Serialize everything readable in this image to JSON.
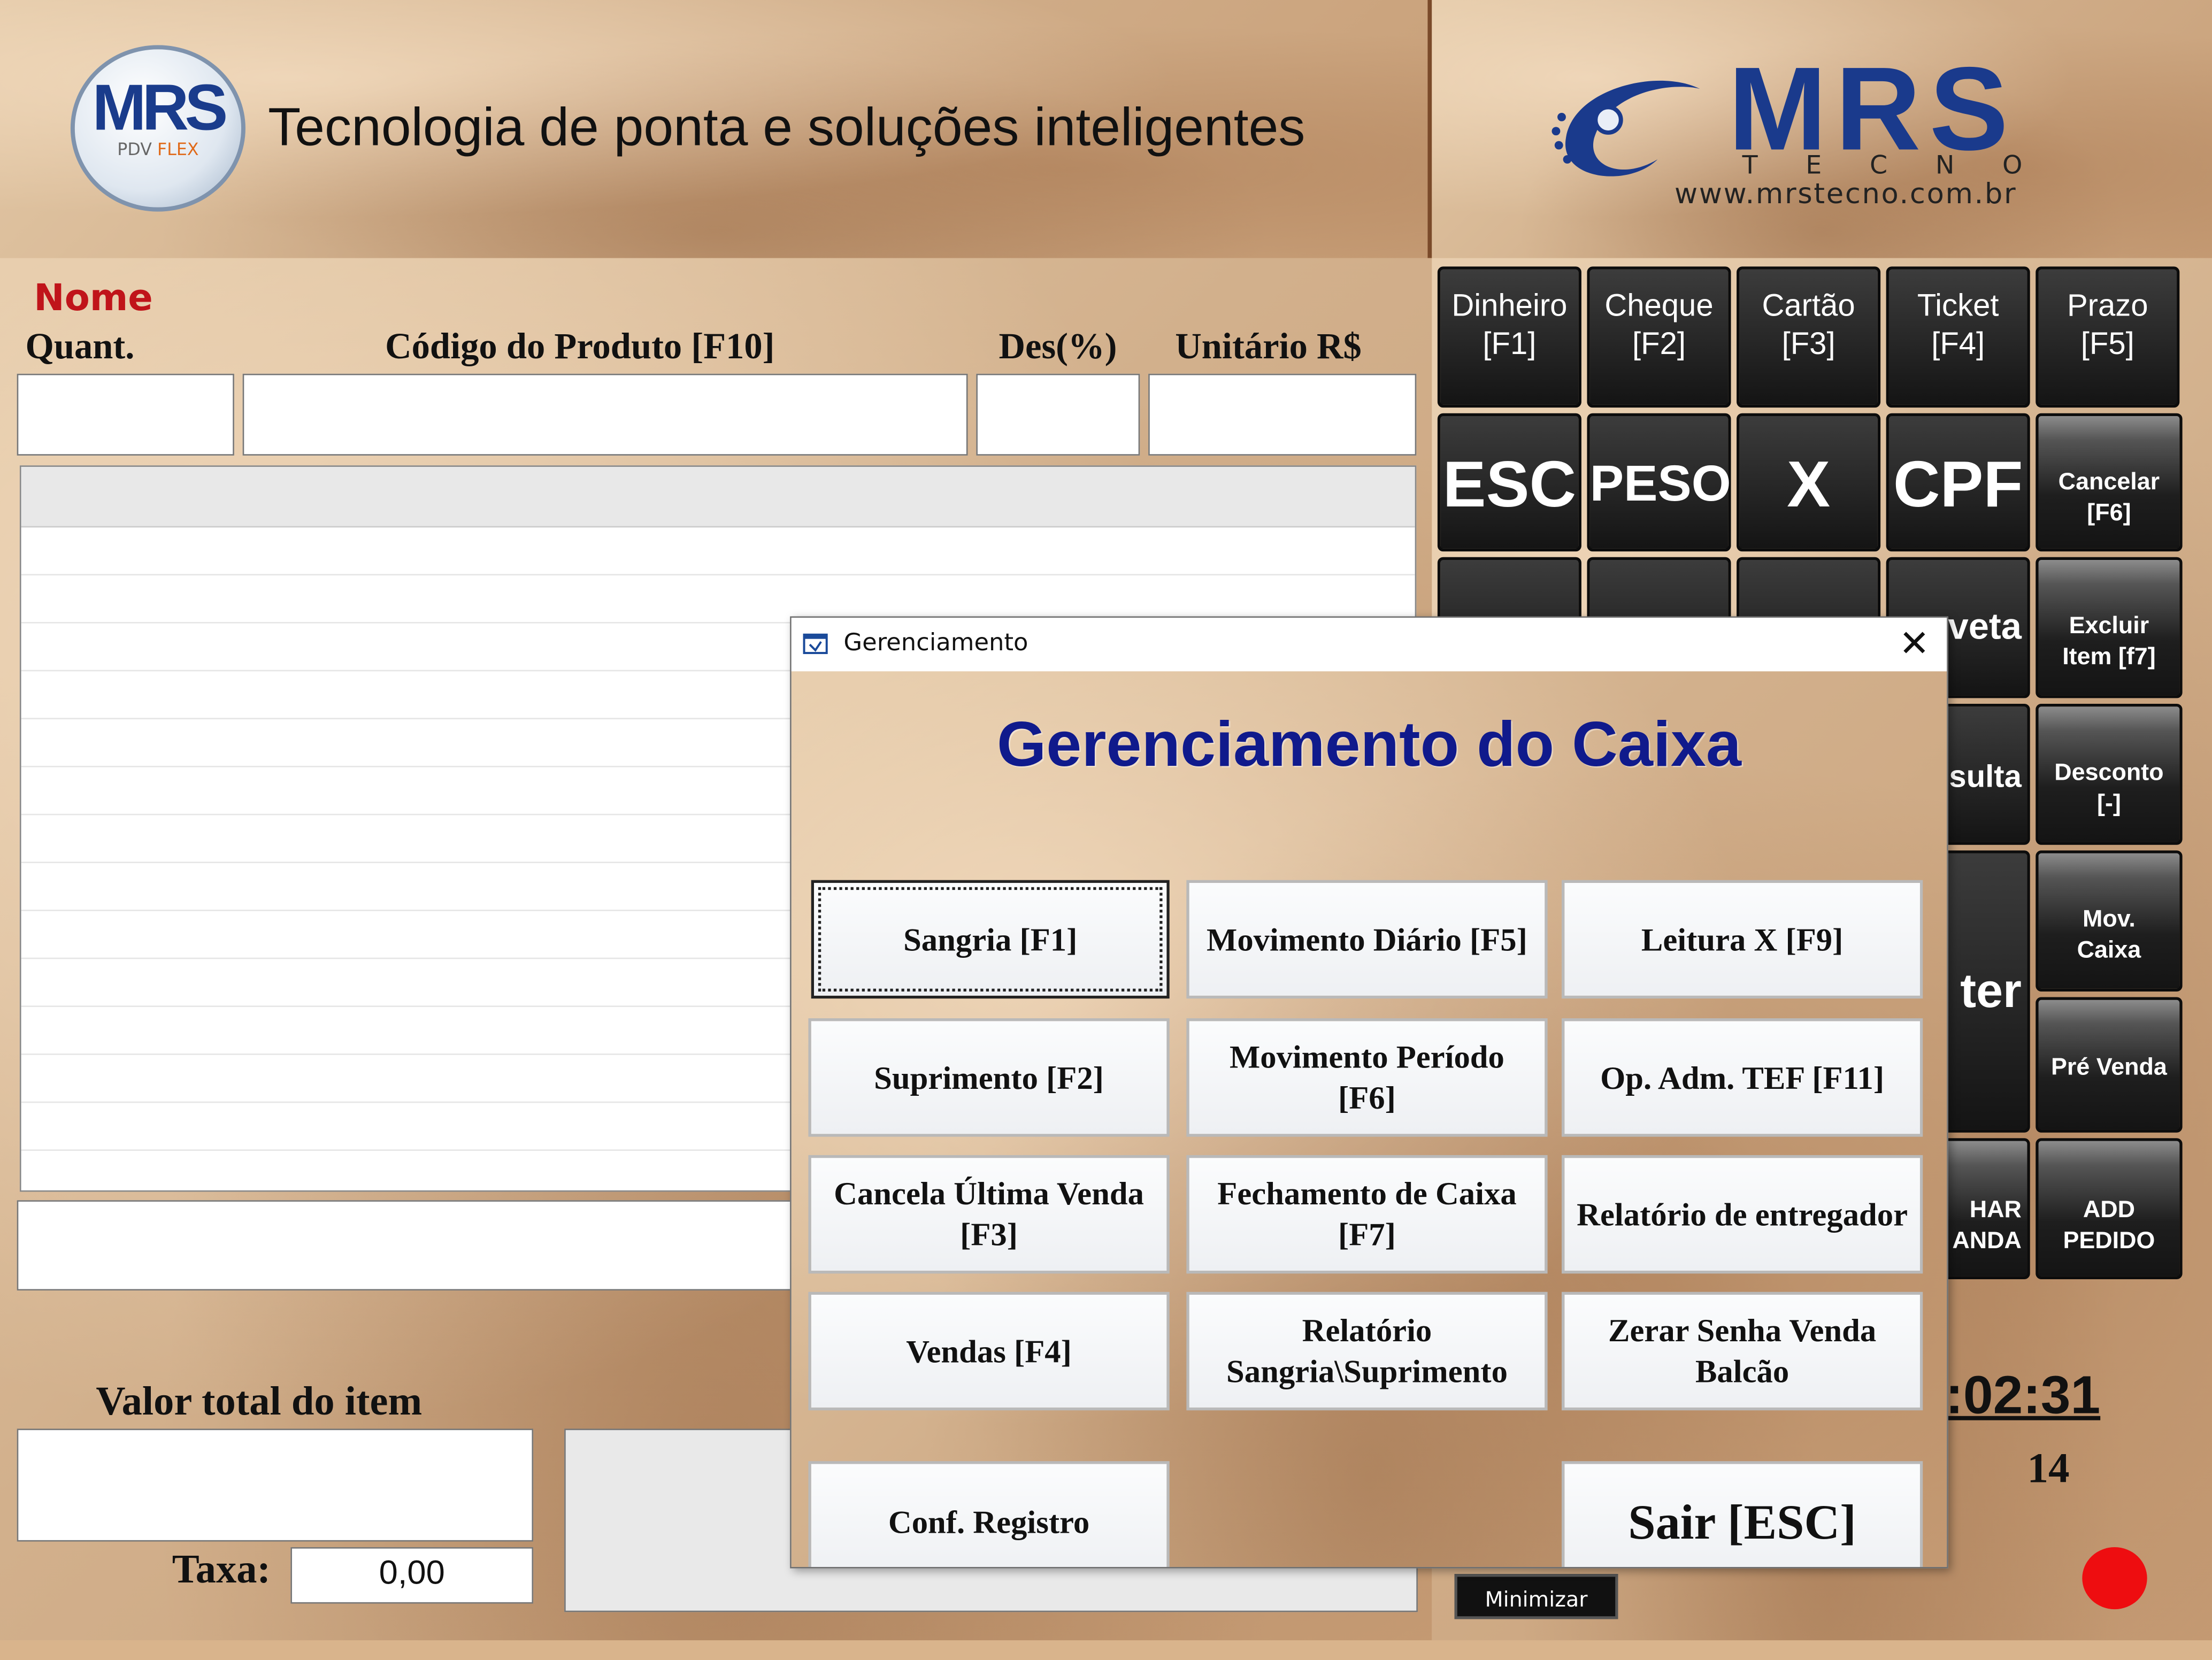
{
  "header": {
    "badge_text": "MRS",
    "badge_sub": "PDV",
    "badge_sub2": "FLEX",
    "tagline": "Tecnologia de ponta e soluções inteligentes",
    "logo_word": "MRS",
    "logo_sub": "TECNO",
    "logo_url": "www.mrstecno.com.br"
  },
  "entry": {
    "nome_label": "Nome",
    "quant_label": "Quant.",
    "codigo_label": "Código do Produto [F10]",
    "des_label": "Des(%)",
    "unitario_label": "Unitário R$",
    "valor_total_label": "Valor total do item",
    "taxa_label": "Taxa:",
    "taxa_value": "0,00"
  },
  "keypad": {
    "pay_keys": [
      {
        "label": "Dinheiro",
        "key": "[F1]"
      },
      {
        "label": "Cheque",
        "key": "[F2]"
      },
      {
        "label": "Cartão",
        "key": "[F3]"
      },
      {
        "label": "Ticket",
        "key": "[F4]"
      },
      {
        "label": "Prazo",
        "key": "[F5]"
      }
    ],
    "esc": "ESC",
    "peso": "PESO",
    "x": "X",
    "cpf": "CPF",
    "cancelar": "Cancelar",
    "cancelar_key": "[F6]",
    "gaveta_partial": "veta",
    "excluir": "Excluir",
    "excluir_key": "Item [f7]",
    "consulta_partial": "sulta",
    "desconto": "Desconto",
    "desconto_key": "[-]",
    "enter_partial": "ter",
    "mov": "Mov.",
    "caixa": "Caixa",
    "pre_venda": "Pré Venda",
    "char_partial": "HAR",
    "anda_partial": "ANDA",
    "add": "ADD",
    "pedido": "PEDIDO",
    "clock": ":02:31",
    "number": "14",
    "minimizar": "Minimizar"
  },
  "dialog": {
    "window_title": "Gerenciamento",
    "heading": "Gerenciamento do Caixa",
    "buttons": [
      {
        "label": "Sangria [F1]"
      },
      {
        "label": "Movimento Diário [F5]"
      },
      {
        "label": "Leitura X [F9]"
      },
      {
        "label": "Suprimento [F2]"
      },
      {
        "label": "Movimento Período\n[F6]"
      },
      {
        "label": "Op. Adm. TEF [F11]"
      },
      {
        "label": "Cancela Última Venda\n[F3]"
      },
      {
        "label": "Fechamento de Caixa\n[F7]"
      },
      {
        "label": "Relatório de entregador"
      },
      {
        "label": "Vendas [F4]"
      },
      {
        "label": "Relatório\nSangria\\Suprimento"
      },
      {
        "label": "Zerar Senha Venda\nBalcão"
      },
      {
        "label": "Conf. Registro"
      },
      {
        "label": "Sair [ESC]"
      }
    ]
  }
}
